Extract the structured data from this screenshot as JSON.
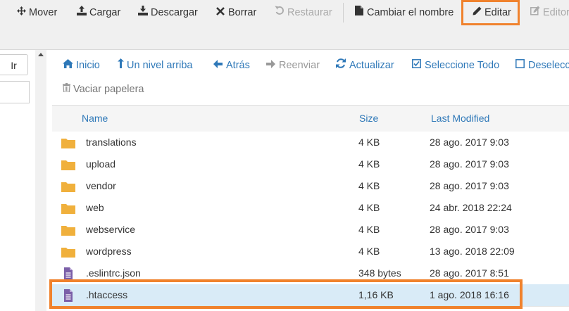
{
  "toolbar": {
    "move": "Mover",
    "upload": "Cargar",
    "download": "Descargar",
    "delete": "Borrar",
    "restore": "Restaurar",
    "rename": "Cambiar el nombre",
    "edit": "Editar",
    "editor": "Editor"
  },
  "left": {
    "go_label": "Ir"
  },
  "actions": {
    "home": "Inicio",
    "up": "Un nivel arriba",
    "back": "Atrás",
    "forward": "Reenviar",
    "refresh": "Actualizar",
    "select_all": "Seleccione Todo",
    "deselect": "Deselecci",
    "empty_trash": "Vaciar papelera"
  },
  "columns": {
    "name": "Name",
    "size": "Size",
    "modified": "Last Modified"
  },
  "files": [
    {
      "name": "translations",
      "size": "4 KB",
      "modified": "28 ago. 2017 9:03",
      "type": "folder"
    },
    {
      "name": "upload",
      "size": "4 KB",
      "modified": "28 ago. 2017 9:03",
      "type": "folder"
    },
    {
      "name": "vendor",
      "size": "4 KB",
      "modified": "28 ago. 2017 9:03",
      "type": "folder"
    },
    {
      "name": "web",
      "size": "4 KB",
      "modified": "24 abr. 2018 22:24",
      "type": "folder"
    },
    {
      "name": "webservice",
      "size": "4 KB",
      "modified": "28 ago. 2017 9:03",
      "type": "folder"
    },
    {
      "name": "wordpress",
      "size": "4 KB",
      "modified": "13 ago. 2018 22:09",
      "type": "folder"
    },
    {
      "name": ".eslintrc.json",
      "size": "348 bytes",
      "modified": "28 ago. 2017 8:51",
      "type": "file"
    },
    {
      "name": ".htaccess",
      "size": "1,16 KB",
      "modified": "1 ago. 2018 16:16",
      "type": "file",
      "selected": true
    }
  ],
  "colors": {
    "accent": "#2e78b8",
    "highlight": "#f0822d",
    "folder": "#f0b03c",
    "file": "#7b5fa8",
    "selected_row": "#d9ebf7"
  }
}
